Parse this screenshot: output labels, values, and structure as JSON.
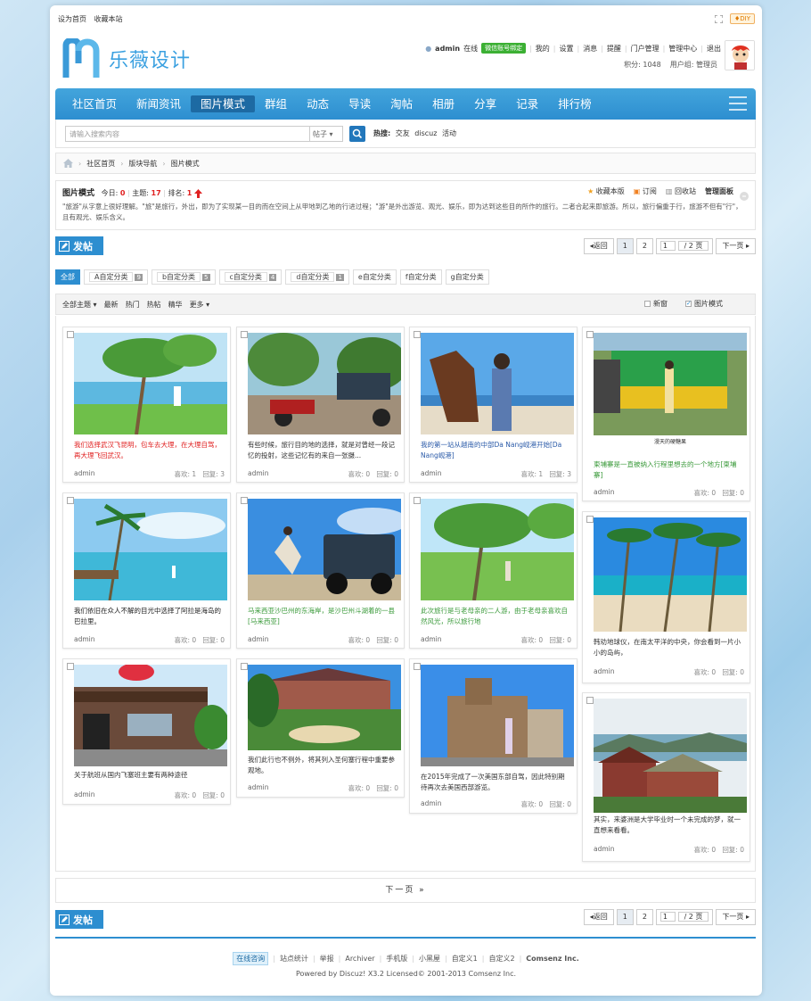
{
  "topbar": {
    "set_home": "设为首页",
    "bookmark": "收藏本站",
    "diy": "♦DIY"
  },
  "logo": {
    "text": "乐薇设计"
  },
  "user": {
    "name": "admin",
    "online": "在线",
    "wechat": "微信账号绑定",
    "mine": "我的",
    "settings": "设置",
    "messages": "消息",
    "remind": "提醒",
    "portal": "门户管理",
    "admin_center": "管理中心",
    "logout": "退出",
    "points": "积分: 1048",
    "group": "用户组: 管理员"
  },
  "nav": [
    "社区首页",
    "新闻资讯",
    "图片模式",
    "群组",
    "动态",
    "导读",
    "淘帖",
    "相册",
    "分享",
    "记录",
    "排行榜"
  ],
  "search": {
    "placeholder": "请输入搜索内容",
    "type": "帖子",
    "hot_label": "热搜:",
    "hot": [
      "交友",
      "discuz",
      "活动"
    ]
  },
  "breadcrumb": [
    "社区首页",
    "版块导航",
    "图片模式"
  ],
  "forum": {
    "name": "图片模式",
    "today_label": "今日:",
    "today": "0",
    "topics_label": "主题:",
    "topics": "17",
    "rank_label": "排名:",
    "rank": "1",
    "desc": "\"旅游\"从字意上很好理解。\"旅\"是旅行，外出，即为了实现某一目的而在空间上从甲地到乙地的行进过程；\"游\"是外出游览、观光、娱乐，即为达到这些目的所作的旅行。二者合起来即旅游。所以，旅行偏重于行，旅游不但有\"行\"，且有观光、娱乐含义。",
    "actions": [
      "收藏本版",
      "订阅",
      "回收站",
      "管理面板"
    ]
  },
  "post_btn": "发帖",
  "pager": {
    "back": "◂返回",
    "p1": "1",
    "p2": "2",
    "input": "1",
    "total": "/ 2 页",
    "next": "下一页 ▸"
  },
  "tabs": [
    {
      "label": "全部",
      "count": ""
    },
    {
      "label": "A自定分类",
      "count": "9"
    },
    {
      "label": "b自定分类",
      "count": "5"
    },
    {
      "label": "c自定分类",
      "count": "4"
    },
    {
      "label": "d自定分类",
      "count": "1"
    },
    {
      "label": "e自定分类",
      "count": ""
    },
    {
      "label": "f自定分类",
      "count": ""
    },
    {
      "label": "g自定分类",
      "count": ""
    }
  ],
  "filter": {
    "items": [
      "全部主题",
      "最新",
      "热门",
      "热帖",
      "精华",
      "更多"
    ],
    "new_window": "新窗",
    "pic_mode": "图片模式"
  },
  "posts": [
    {
      "title": "我们选择武汉飞昆明，包车去大理，在大理自驾，再大理飞回武汉。",
      "author": "admin",
      "likes": "喜欢: 1",
      "replies": "回复: 3",
      "color": "#e02020"
    },
    {
      "title": "有些时候，旅行目的地的选择，就是对曾经一段记忆的投射，这些记忆有的来自一张摄...",
      "author": "admin",
      "likes": "喜欢: 0",
      "replies": "回复: 0",
      "color": "#333333"
    },
    {
      "title": "我的第一站从越南的中部Da Nang岘港开始[Da Nang岘港]",
      "author": "admin",
      "likes": "喜欢: 1",
      "replies": "回复: 3",
      "color": "#2a5aa8"
    },
    {
      "title": "柬埔寨是一直被纳入行程里想去的一个地方[柬埔寨]",
      "author": "admin",
      "likes": "喜欢: 0",
      "replies": "回复: 0",
      "color": "#3a9a3a"
    },
    {
      "title": "我们依旧在众人不解的目光中选择了阿拉是海岛的巴拉里。",
      "author": "admin",
      "likes": "喜欢: 0",
      "replies": "回复: 0",
      "color": "#222222"
    },
    {
      "title": "马来西亚沙巴州的东海岸，是沙巴州斗湖着的一县[马来西亚]",
      "author": "admin",
      "likes": "喜欢: 0",
      "replies": "回复: 0",
      "color": "#3a9a3a"
    },
    {
      "title": "此次旅行是与老母亲的二人游，由于老母亲喜欢自然风光，所以旅行地",
      "author": "admin",
      "likes": "喜欢: 0",
      "replies": "回复: 0",
      "color": "#3a9a3a"
    },
    {
      "title": "韩劝地球仪，在南太平洋的中央，你会看到一片小小的岛屿，",
      "author": "admin",
      "likes": "喜欢: 0",
      "replies": "回复: 0",
      "color": "#333333"
    },
    {
      "title": "关于航班从国内飞塞班主要有两种途径",
      "author": "admin",
      "likes": "喜欢: 0",
      "replies": "回复: 0",
      "color": "#333333"
    },
    {
      "title": "我们此行也不例外，将其列入圣何塞行程中重要参观地。",
      "author": "admin",
      "likes": "喜欢: 0",
      "replies": "回复: 0",
      "color": "#333333"
    },
    {
      "title": "在2015年完成了一次美国东部自驾，因此特别期待再次去美国西部游览。",
      "author": "admin",
      "likes": "喜欢: 0",
      "replies": "回复: 0",
      "color": "#333333"
    },
    {
      "title": "其实，来婆洲是大学毕业时一个未完成的梦，就一直想来看看。",
      "author": "admin",
      "likes": "喜欢: 0",
      "replies": "回复: 0",
      "color": "#333333"
    }
  ],
  "next_page": "下一页 »",
  "footer": {
    "online": "在线咨询",
    "links": [
      "站点统计",
      "举报",
      "Archiver",
      "手机版",
      "小黑屋",
      "自定义1",
      "自定义2",
      "Comsenz Inc."
    ],
    "powered": "Powered by Discuz! X3.2 Licensed© 2001-2013 Comsenz Inc."
  },
  "colors": {
    "accent": "#2d8ed0",
    "nav": "#3a9ad8",
    "red": "#e02020"
  }
}
